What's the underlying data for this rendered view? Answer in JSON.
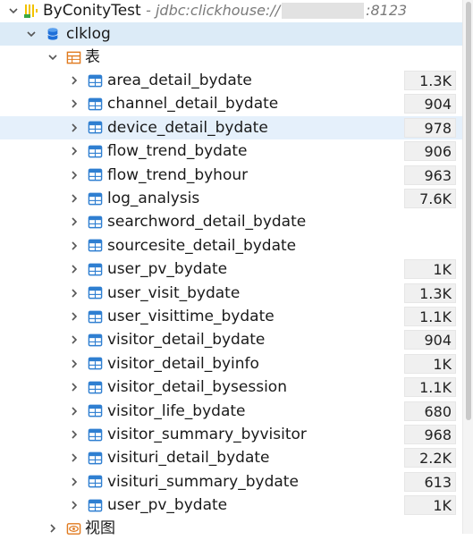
{
  "connection": {
    "name": "ByConityTest",
    "url_prefix": "- jdbc:clickhouse://",
    "url_suffix": ":8123"
  },
  "database": {
    "name": "clklog"
  },
  "tables_folder": {
    "label": "表"
  },
  "views_folder": {
    "label": "视图"
  },
  "tables": [
    {
      "name": "area_detail_bydate",
      "count": "1.3K"
    },
    {
      "name": "channel_detail_bydate",
      "count": "904"
    },
    {
      "name": "device_detail_bydate",
      "count": "978"
    },
    {
      "name": "flow_trend_bydate",
      "count": "906"
    },
    {
      "name": "flow_trend_byhour",
      "count": "963"
    },
    {
      "name": "log_analysis",
      "count": "7.6K"
    },
    {
      "name": "searchword_detail_bydate",
      "count": ""
    },
    {
      "name": "sourcesite_detail_bydate",
      "count": ""
    },
    {
      "name": "user_pv_bydate",
      "count": "1K"
    },
    {
      "name": "user_visit_bydate",
      "count": "1.3K"
    },
    {
      "name": "user_visittime_bydate",
      "count": "1.1K"
    },
    {
      "name": "visitor_detail_bydate",
      "count": "904"
    },
    {
      "name": "visitor_detail_byinfo",
      "count": "1K"
    },
    {
      "name": "visitor_detail_bysession",
      "count": "1.1K"
    },
    {
      "name": "visitor_life_bydate",
      "count": "680"
    },
    {
      "name": "visitor_summary_byvisitor",
      "count": "968"
    },
    {
      "name": "visituri_detail_bydate",
      "count": "2.2K"
    },
    {
      "name": "visituri_summary_bydate",
      "count": "613"
    },
    {
      "name": "user_pv_bydate",
      "count": "1K"
    }
  ],
  "selected_table_index": 2,
  "colors": {
    "selection": "#dcebf7",
    "table_icon": "#2f7fd1",
    "folder_icon": "#e07a1f",
    "db_icon": "#1e6fd9"
  }
}
